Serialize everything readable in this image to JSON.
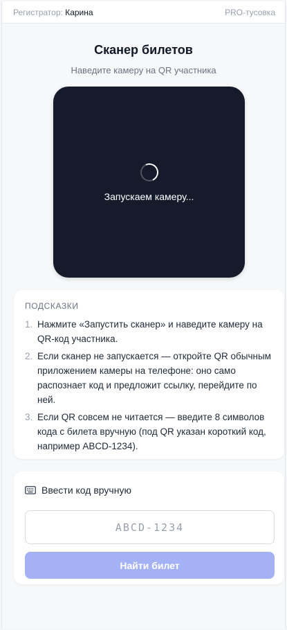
{
  "header": {
    "registrar_label": "Регистратор:",
    "registrar_name": "Карина",
    "brand": "PRO-тусовка"
  },
  "scanner": {
    "title": "Сканер билетов",
    "subtitle": "Наведите камеру на QR участника",
    "status": "Запускаем камеру..."
  },
  "tips": {
    "heading": "ПОДСКАЗКИ",
    "items": [
      {
        "num": "1.",
        "text": "Нажмите «Запустить сканер» и наведите камеру на QR-код участника."
      },
      {
        "num": "2.",
        "text": "Если сканер не запускается — откройте QR обычным приложением камеры на телефоне: оно само распознает код и предложит ссылку, перейдите по ней."
      },
      {
        "num": "3.",
        "text": "Если QR совсем не читается — введите 8 символов кода с билета вручную (под QR указан короткий код, например ABCD-1234)."
      }
    ]
  },
  "manual": {
    "heading": "Ввести код вручную",
    "icon": "keyboard-icon",
    "input_value": "",
    "input_placeholder": "ABCD-1234",
    "button_label": "Найти билет"
  },
  "colors": {
    "camera_bg": "#161b2c",
    "button_disabled": "#a4b1f5",
    "page_bg": "#f7f8fa"
  }
}
